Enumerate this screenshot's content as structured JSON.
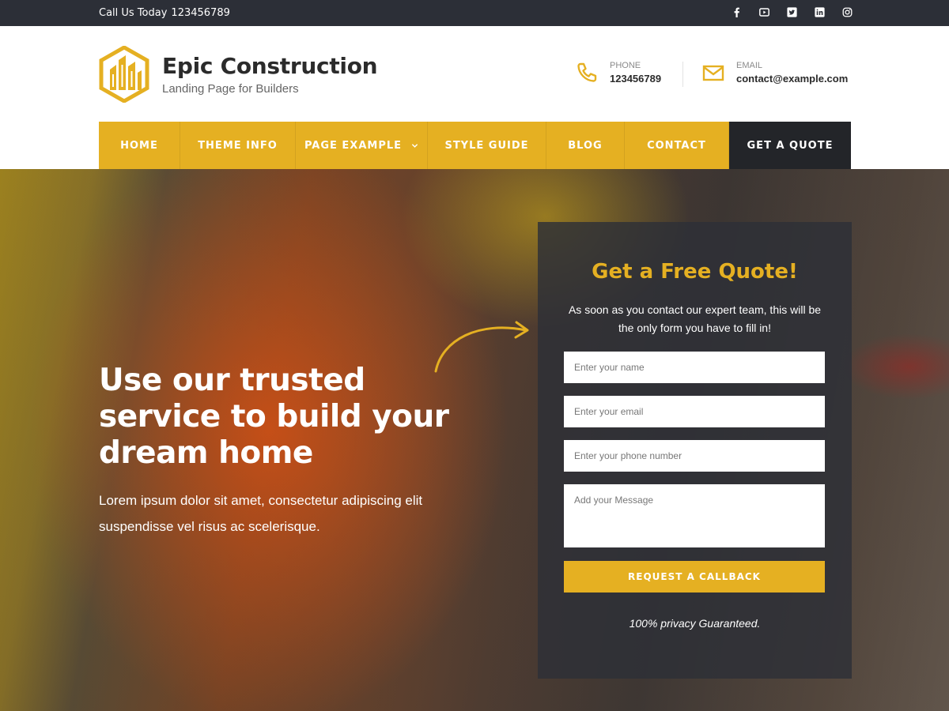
{
  "topbar": {
    "call_label": "Call Us Today",
    "call_number": "123456789",
    "socials": [
      "facebook-icon",
      "youtube-icon",
      "twitter-icon",
      "linkedin-icon",
      "instagram-icon"
    ]
  },
  "header": {
    "brand_title": "Epic Construction",
    "brand_tagline": "Landing Page for Builders",
    "phone_label": "PHONE",
    "phone_value": "123456789",
    "email_label": "EMAIL",
    "email_value": "contact@example.com"
  },
  "nav": {
    "items": [
      {
        "label": "HOME"
      },
      {
        "label": "THEME INFO"
      },
      {
        "label": "PAGE EXAMPLE",
        "has_dropdown": true
      },
      {
        "label": "STYLE GUIDE"
      },
      {
        "label": "BLOG"
      },
      {
        "label": "CONTACT"
      }
    ],
    "cta_label": "GET A QUOTE"
  },
  "hero": {
    "heading": "Use our trusted service to build your dream home",
    "subtext": "Lorem ipsum dolor sit amet, consectetur adipiscing elit suspendisse vel risus ac scelerisque."
  },
  "quote_form": {
    "title": "Get a Free Quote!",
    "description": "As soon as you contact our expert team, this will be the only form you have to fill in!",
    "name_placeholder": "Enter your name",
    "email_placeholder": "Enter your email",
    "phone_placeholder": "Enter your phone number",
    "message_placeholder": "Add your Message",
    "submit_label": "REQUEST A CALLBACK",
    "privacy_note": "100% privacy Guaranteed."
  },
  "colors": {
    "accent": "#e5b022",
    "topbar_bg": "#2c2f37",
    "cta_bg": "#232529",
    "text_dark": "#2b2b2b"
  }
}
